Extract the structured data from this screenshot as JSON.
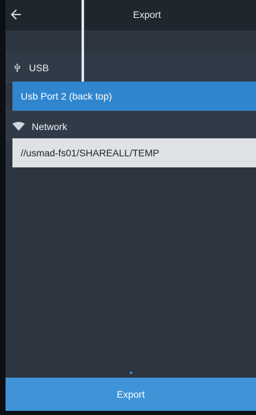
{
  "header": {
    "title": "Export"
  },
  "sections": {
    "usb": {
      "label": "USB",
      "icon": "usb-icon",
      "selected_device": "Usb Port 2 (back top)"
    },
    "network": {
      "label": "Network",
      "icon": "wifi-icon",
      "path": "//usmad-fs01/SHAREALL/TEMP"
    }
  },
  "footer": {
    "primary_action": "Export"
  },
  "colors": {
    "accent": "#3f93d6",
    "selected_row": "#2f86cf",
    "panel": "#2c3540",
    "topbar": "#1f262e",
    "light_row": "#dfe2e5"
  },
  "pager": {
    "current_page": 1
  }
}
